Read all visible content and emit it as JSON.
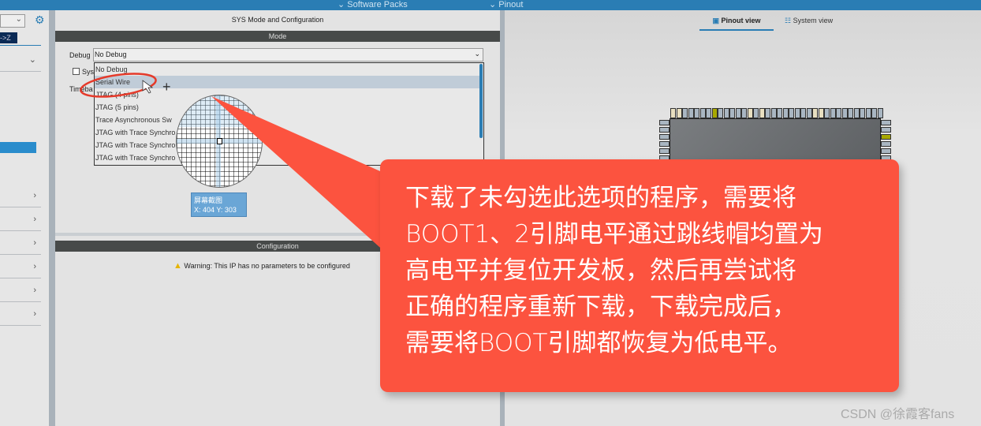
{
  "topbar": {
    "software_packs": "Software Packs",
    "pinout": "Pinout"
  },
  "sidebar": {
    "sort_label": "->Z"
  },
  "panel": {
    "title": "SYS Mode and Configuration",
    "mode_header": "Mode",
    "debug_label": "Debug",
    "debug_value": "No Debug",
    "sys_checkbox_label": "Sys",
    "timebase_label": "Timeba",
    "debug_options": [
      "No Debug",
      "Serial Wire",
      "JTAG (4 pins)",
      "JTAG (5 pins)",
      "Trace Asynchronous Sw",
      "JTAG with Trace Synchro",
      "JTAG with Trace Synchro",
      "JTAG with Trace Synchro"
    ],
    "selected_option": "Serial Wire",
    "config_header": "Configuration",
    "warning": "Warning: This IP has no parameters to be configured"
  },
  "screenshot_tool": {
    "title": "屏幕截图",
    "coords": "X: 404 Y: 303"
  },
  "right": {
    "tabs": [
      {
        "label": "Pinout view",
        "active": true
      },
      {
        "label": "System view",
        "active": false
      }
    ]
  },
  "callout": {
    "lines": [
      "下载了未勾选此选项的程序，需要将",
      "BOOT1、2引脚电平通过跳线帽均置为",
      "高电平并复位开发板，然后再尝试将",
      "正确的程序重新下载，下载完成后，",
      "需要将BOOT引脚都恢复为低电平。"
    ],
    "color": "#fc533f"
  },
  "watermark": "CSDN @徐霞客fans"
}
